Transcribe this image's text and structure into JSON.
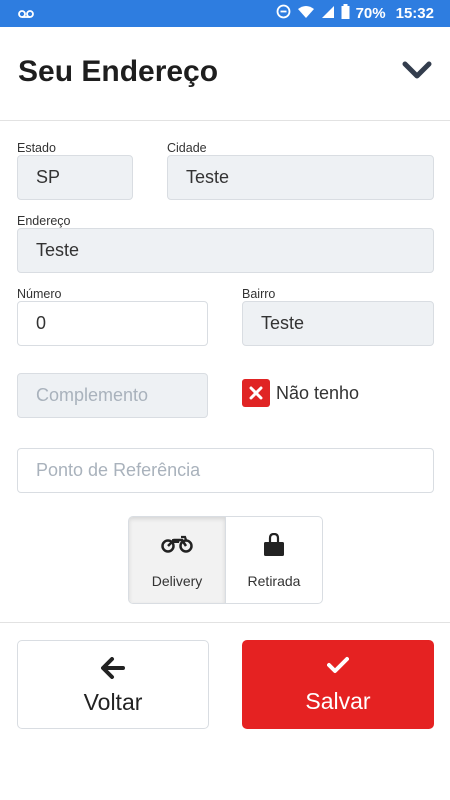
{
  "status_bar": {
    "battery": "70%",
    "time": "15:32"
  },
  "header": {
    "title": "Seu Endereço"
  },
  "form": {
    "estado": {
      "label": "Estado",
      "value": "SP"
    },
    "cidade": {
      "label": "Cidade",
      "value": "Teste"
    },
    "endereco": {
      "label": "Endereço",
      "value": "Teste"
    },
    "numero": {
      "label": "Número",
      "value": "0"
    },
    "bairro": {
      "label": "Bairro",
      "value": "Teste"
    },
    "complemento": {
      "placeholder": "Complemento"
    },
    "nao_tenho": {
      "label": "Não tenho"
    },
    "referencia": {
      "placeholder": "Ponto de Referência"
    }
  },
  "delivery_mode": {
    "selected": "Delivery",
    "options": [
      {
        "label": "Delivery",
        "icon": "motorcycle-icon"
      },
      {
        "label": "Retirada",
        "icon": "shopping-bag-icon"
      }
    ]
  },
  "actions": {
    "back": {
      "label": "Voltar",
      "icon": "arrow-left-icon"
    },
    "save": {
      "label": "Salvar",
      "icon": "check-icon"
    }
  },
  "colors": {
    "status_bar": "#2e7de0",
    "accent_red": "#e52222"
  }
}
